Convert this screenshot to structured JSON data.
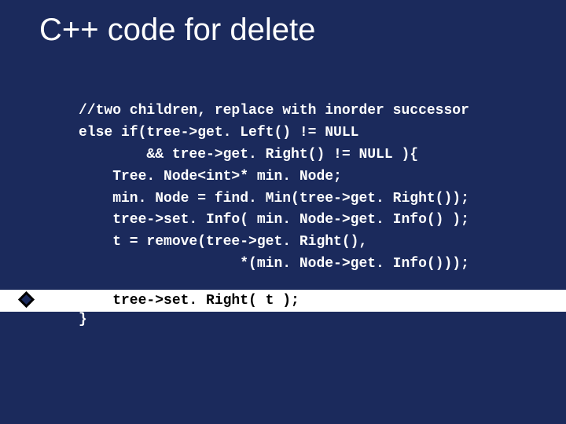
{
  "slide": {
    "title": "C++ code for delete",
    "code_lines": "//two children, replace with inorder successor\nelse if(tree->get. Left() != NULL\n        && tree->get. Right() != NULL ){\n    Tree. Node<int>* min. Node;\n    min. Node = find. Min(tree->get. Right());\n    tree->set. Info( min. Node->get. Info() );\n    t = remove(tree->get. Right(),\n                   *(min. Node->get. Info()));",
    "highlight_line": "    tree->set. Right( t );",
    "closing": "}",
    "bullet_name": "diamond-bullet-icon"
  },
  "colors": {
    "background": "#1b2a5c",
    "text": "#ffffff",
    "highlight_bg": "#ffffff",
    "highlight_text": "#000000"
  }
}
